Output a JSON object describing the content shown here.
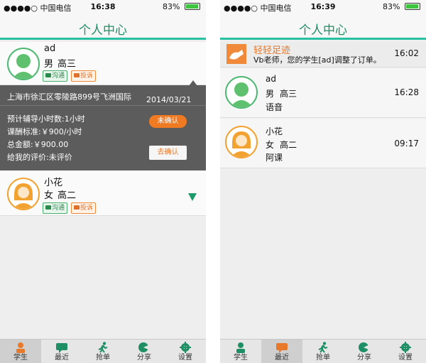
{
  "left_screen": {
    "status_bar": {
      "carrier": "●●●●○ 中国电信",
      "time": "16:38",
      "battery": "83%",
      "battery_level": 0.83
    },
    "nav_title": "个人中心",
    "students": [
      {
        "name": "ad",
        "gender": "男",
        "grade": "高三",
        "talk_label": "沟通",
        "complain_label": "投诉",
        "avatar_icon": "boy-avatar-icon",
        "order": {
          "address": "上海市徐汇区零陵路899号飞洲国际",
          "date": "2014/03/21",
          "hours": "预计辅导小时数:1小时",
          "rate": "课酬标准:￥900/小时",
          "total": "总金额:￥900.00",
          "rating": "给我的评价:未评价",
          "status_label": "未确认",
          "confirm_label": "去确认"
        }
      },
      {
        "name": "小花",
        "gender": "女",
        "grade": "高二",
        "talk_label": "沟通",
        "complain_label": "投诉",
        "avatar_icon": "girl-avatar-icon"
      }
    ],
    "tabs": [
      {
        "label": "学生",
        "icon": "student-icon",
        "active": true
      },
      {
        "label": "最近",
        "icon": "chat-icon",
        "active": false
      },
      {
        "label": "抢单",
        "icon": "runner-icon",
        "active": false
      },
      {
        "label": "分享",
        "icon": "share-icon",
        "active": false
      },
      {
        "label": "设置",
        "icon": "gear-icon",
        "active": false
      }
    ]
  },
  "right_screen": {
    "status_bar": {
      "carrier": "●●●●○ 中国电信",
      "time": "16:39",
      "battery": "83%",
      "battery_level": 0.83
    },
    "nav_title": "个人中心",
    "notice": {
      "title": "轻轻足迹",
      "text": "Vb老师，您的学生[ad]调整了订单。",
      "time": "16:02"
    },
    "messages": [
      {
        "name": "ad",
        "gender": "男",
        "grade": "高三",
        "last_message": "语音",
        "time": "16:28",
        "avatar_icon": "boy-avatar-icon"
      },
      {
        "name": "小花",
        "gender": "女",
        "grade": "高二",
        "last_message": "阿课",
        "time": "09:17",
        "avatar_icon": "girl-avatar-icon"
      }
    ],
    "tabs": [
      {
        "label": "学生",
        "icon": "student-icon",
        "active": false
      },
      {
        "label": "最近",
        "icon": "chat-icon",
        "active": true
      },
      {
        "label": "抢单",
        "icon": "runner-icon",
        "active": false
      },
      {
        "label": "分享",
        "icon": "share-icon",
        "active": false
      },
      {
        "label": "设置",
        "icon": "gear-icon",
        "active": false
      }
    ]
  },
  "colors": {
    "accent_green": "#1e8e65",
    "orange": "#ef7a22",
    "panel_gray": "#5c5c5c"
  }
}
